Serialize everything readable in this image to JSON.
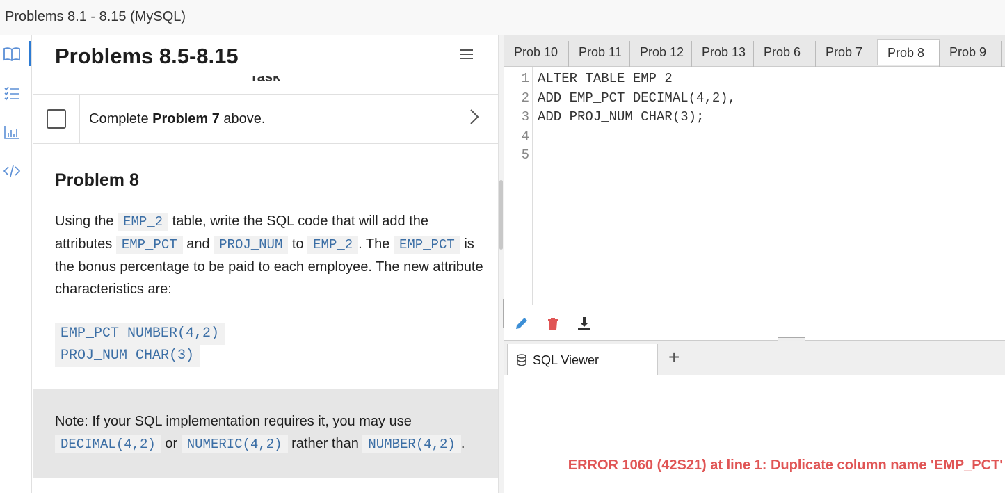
{
  "window": {
    "title": "Problems 8.1 - 8.15 (MySQL)"
  },
  "rail": {
    "icons": [
      "book-icon",
      "checklist-icon",
      "chart-icon",
      "code-icon"
    ]
  },
  "left": {
    "header_title": "Problems 8.5-8.15",
    "task_heading": "Task",
    "task": {
      "prefix": "Complete ",
      "bold": "Problem 7",
      "suffix": " above."
    },
    "problem_title": "Problem 8",
    "p": {
      "t1": "Using the ",
      "c1": "EMP_2",
      "t2": " table, write the SQL code that will add the attributes ",
      "c2": "EMP_PCT",
      "t3": " and ",
      "c3": "PROJ_NUM",
      "t4": " to ",
      "c4": "EMP_2",
      "t5": ". The ",
      "c5": "EMP_PCT",
      "t6": " is the bonus percentage to be paid to each employee. The new attribute characteristics are:"
    },
    "code_lines": [
      "EMP_PCT NUMBER(4,2)",
      "PROJ_NUM CHAR(3)"
    ],
    "note": {
      "t1": "Note: If your SQL implementation requires it, you may use ",
      "c1": "DECIMAL(4,2)",
      "t2": " or ",
      "c2": "NUMERIC(4,2)",
      "t3": " rather than ",
      "c3": "NUMBER(4,2)",
      "t4": "."
    }
  },
  "tabs": [
    "Prob 10",
    "Prob 11",
    "Prob 12",
    "Prob 13",
    "Prob 6",
    "Prob 7",
    "Prob 8",
    "Prob 9"
  ],
  "active_tab": "Prob 8",
  "editor": {
    "line_numbers": [
      "1",
      "2",
      "3",
      "4",
      "5"
    ],
    "lines": [
      "ALTER TABLE EMP_2",
      "ADD EMP_PCT DECIMAL(4,2),",
      "ADD PROJ_NUM CHAR(3);",
      "",
      ""
    ]
  },
  "toolbar": {
    "edit_color": "#3d8fd6",
    "delete_color": "#e05555",
    "download_color": "#333333"
  },
  "viewer": {
    "tab_label": "SQL Viewer",
    "add_label": "+",
    "error": "ERROR 1060 (42S21) at line 1: Duplicate column name 'EMP_PCT'"
  }
}
